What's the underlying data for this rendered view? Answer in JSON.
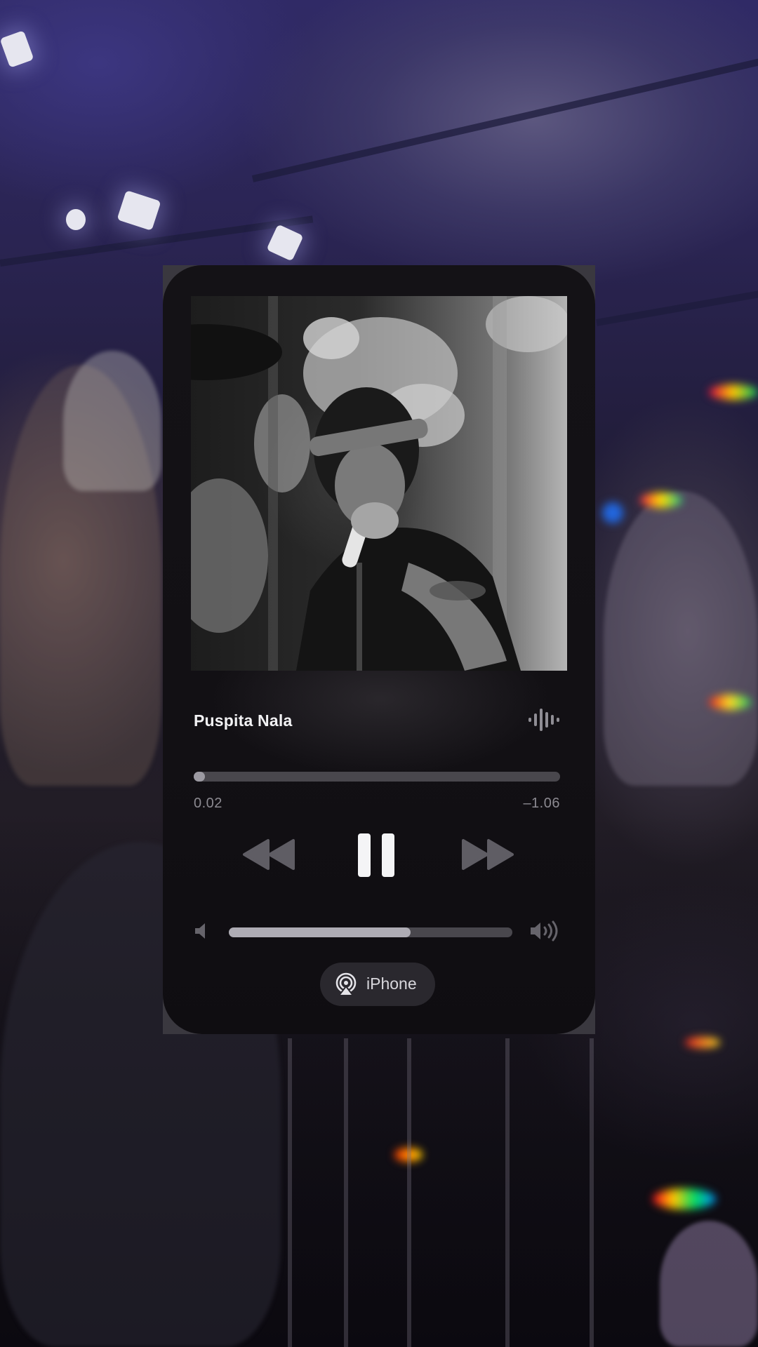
{
  "now_playing": {
    "title": "Puspita Nala",
    "elapsed": "0.02",
    "remaining": "–1.06",
    "progress_fraction": 0.03,
    "volume_fraction": 0.64,
    "output_device": "iPhone"
  },
  "icons": {
    "waveform": "waveform-icon",
    "rewind": "backward-icon",
    "pause": "pause-icon",
    "forward": "forward-icon",
    "volume_low": "speaker-low-icon",
    "volume_high": "speaker-high-icon",
    "airplay": "airplay-icon"
  },
  "colors": {
    "card_background": "#131115",
    "track_empty": "#49474d",
    "track_fill": "#aeacb4",
    "title_text": "#f2f2f4",
    "secondary_text": "#8c8a91"
  }
}
